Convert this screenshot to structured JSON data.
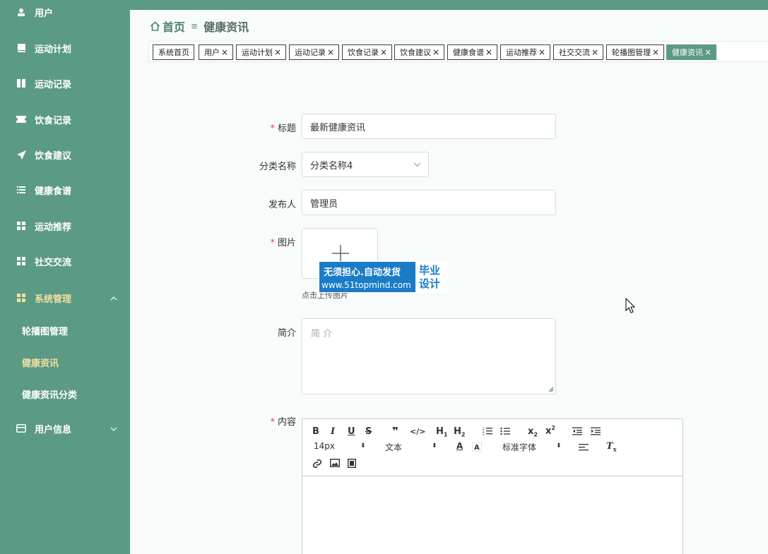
{
  "sidebar": {
    "items": [
      {
        "label": "用户",
        "icon": "user-icon"
      },
      {
        "label": "运动计划",
        "icon": "book-icon"
      },
      {
        "label": "运动记录",
        "icon": "notebook-icon"
      },
      {
        "label": "饮食记录",
        "icon": "ticket-icon"
      },
      {
        "label": "饮食建议",
        "icon": "send-icon"
      },
      {
        "label": "健康食谱",
        "icon": "list-icon"
      },
      {
        "label": "运动推荐",
        "icon": "grid-icon"
      },
      {
        "label": "社交交流",
        "icon": "grid-icon"
      },
      {
        "label": "系统管理",
        "icon": "grid-icon"
      },
      {
        "label": "用户信息",
        "icon": "card-icon"
      }
    ],
    "sub_items": [
      {
        "label": "轮播图管理"
      },
      {
        "label": "健康资讯"
      },
      {
        "label": "健康资讯分类"
      }
    ],
    "accent_color": "#f3dfa0"
  },
  "breadcrumb": {
    "home": "首页",
    "current": "健康资讯"
  },
  "tags": [
    {
      "label": "系统首页"
    },
    {
      "label": "用户"
    },
    {
      "label": "运动计划"
    },
    {
      "label": "运动记录"
    },
    {
      "label": "饮食记录"
    },
    {
      "label": "饮食建议"
    },
    {
      "label": "健康食谱"
    },
    {
      "label": "运动推荐"
    },
    {
      "label": "社交交流"
    },
    {
      "label": "轮播图管理"
    },
    {
      "label": "健康资讯"
    }
  ],
  "form": {
    "title_label": "标题",
    "title_value": "最新健康资讯",
    "category_label": "分类名称",
    "category_value": "分类名称4",
    "publisher_label": "发布人",
    "publisher_value": "管理员",
    "image_label": "图片",
    "upload_hint": "点击上传图片",
    "summary_label": "简介",
    "summary_placeholder": "简 介",
    "content_label": "内容"
  },
  "editor": {
    "font_size": "14px",
    "text_type": "文本",
    "font_family": "标准字体"
  },
  "watermark": {
    "line1": "无须担心.自动发货",
    "line2": "www.51topmind.com",
    "badge1": "毕业",
    "badge2": "设计"
  },
  "colors": {
    "primary": "#5b9a85",
    "required": "#e24b3b"
  }
}
